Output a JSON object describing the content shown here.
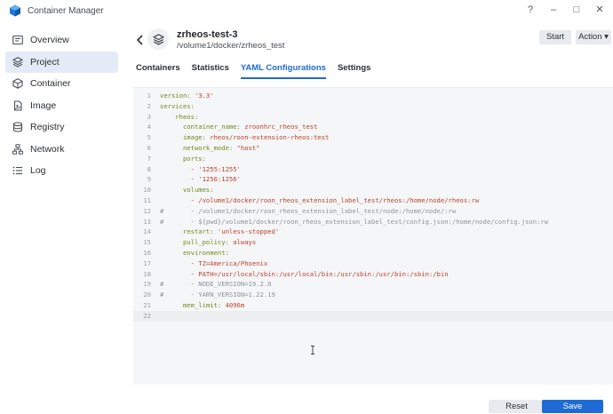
{
  "app": {
    "title": "Container Manager",
    "controls": {
      "help": "?",
      "minimize": "–",
      "maximize": "□",
      "close": "✕"
    }
  },
  "sidebar": {
    "items": [
      {
        "label": "Overview",
        "icon": "overview-icon",
        "active": false
      },
      {
        "label": "Project",
        "icon": "project-icon",
        "active": true
      },
      {
        "label": "Container",
        "icon": "container-icon",
        "active": false
      },
      {
        "label": "Image",
        "icon": "image-icon",
        "active": false
      },
      {
        "label": "Registry",
        "icon": "registry-icon",
        "active": false
      },
      {
        "label": "Network",
        "icon": "network-icon",
        "active": false
      },
      {
        "label": "Log",
        "icon": "log-icon",
        "active": false
      }
    ]
  },
  "project": {
    "name": "zrheos-test-3",
    "path": "/volume1/docker/zrheos_test",
    "start_label": "Start",
    "action_label": "Action ▾"
  },
  "tabs": [
    {
      "label": "Containers",
      "active": false
    },
    {
      "label": "Statistics",
      "active": false
    },
    {
      "label": "YAML Configurations",
      "active": true
    },
    {
      "label": "Settings",
      "active": false
    }
  ],
  "yaml": {
    "current_line": 22,
    "lines": [
      {
        "n": "1",
        "comment": "",
        "text": "version: '3.3'",
        "kind": "kv"
      },
      {
        "n": "2",
        "comment": "",
        "text": "services:",
        "kind": "key"
      },
      {
        "n": "3",
        "comment": "",
        "text": "    rheos:",
        "kind": "key"
      },
      {
        "n": "4",
        "comment": "",
        "text": "      container_name: zroonhrc_rheos_test",
        "kind": "kv"
      },
      {
        "n": "5",
        "comment": "",
        "text": "      image: rheos/roon-extension-rheos:test",
        "kind": "kv"
      },
      {
        "n": "6",
        "comment": "",
        "text": "      network_mode: \"host\"",
        "kind": "kv"
      },
      {
        "n": "7",
        "comment": "",
        "text": "      ports:",
        "kind": "key"
      },
      {
        "n": "8",
        "comment": "",
        "text": "        - '1255:1255'",
        "kind": "item"
      },
      {
        "n": "9",
        "comment": "",
        "text": "        - '1256:1256'",
        "kind": "item"
      },
      {
        "n": "10",
        "comment": "",
        "text": "      volumes:",
        "kind": "key"
      },
      {
        "n": "11",
        "comment": "",
        "text": "        - /volume1/docker/roon_rheos_extension_label_test/rheos:/home/node/rheos:rw",
        "kind": "item"
      },
      {
        "n": "12",
        "comment": "#",
        "text": "        - /volume1/docker/roon_rheos_extension_label_test/node:/home/node/:rw",
        "kind": "comment"
      },
      {
        "n": "13",
        "comment": "#",
        "text": "        - ${pwd}/volume1/docker/roon_rheos_extension_label_test/config.json:/home/node/config.json:rw",
        "kind": "comment"
      },
      {
        "n": "14",
        "comment": "",
        "text": "      restart: 'unless-stopped'",
        "kind": "kv"
      },
      {
        "n": "15",
        "comment": "",
        "text": "      pull_policy: always",
        "kind": "kv"
      },
      {
        "n": "16",
        "comment": "",
        "text": "      environment:",
        "kind": "key"
      },
      {
        "n": "17",
        "comment": "",
        "text": "        - TZ=America/Phoenix",
        "kind": "item"
      },
      {
        "n": "18",
        "comment": "",
        "text": "        - PATH=/usr/local/sbin:/usr/local/bin:/usr/sbin:/usr/bin:/sbin:/bin",
        "kind": "item"
      },
      {
        "n": "19",
        "comment": "#",
        "text": "        - NODE_VERSION=19.2.0",
        "kind": "comment"
      },
      {
        "n": "20",
        "comment": "#",
        "text": "        - YARN_VERSION=1.22.19",
        "kind": "comment"
      },
      {
        "n": "21",
        "comment": "",
        "text": "      mem_limit: 4096m",
        "kind": "kv"
      },
      {
        "n": "22",
        "comment": "",
        "text": "",
        "kind": "blank"
      }
    ]
  },
  "footer": {
    "reset_label": "Reset",
    "save_label": "Save"
  },
  "colors": {
    "accent": "#1e6bd6",
    "yaml_key": "#6f8a1f",
    "yaml_value": "#c0412b",
    "yaml_comment": "#8d949a"
  }
}
